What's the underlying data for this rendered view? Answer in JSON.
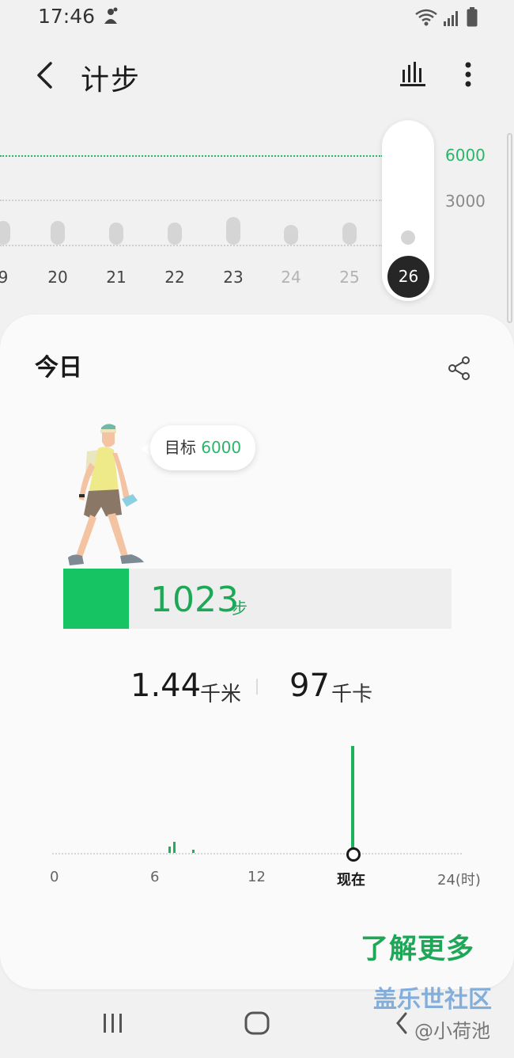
{
  "status_bar": {
    "time": "17:46",
    "icons": [
      "notification-icon",
      "wifi-icon",
      "signal-icon",
      "battery-icon"
    ]
  },
  "header": {
    "title": "计步",
    "icons": [
      "back-arrow-icon",
      "bar-chart-icon",
      "more-vertical-icon"
    ]
  },
  "week_chart": {
    "goal_label": "6000",
    "mid_label": "3000",
    "days": [
      {
        "label": "9",
        "steps": 1200,
        "future": false
      },
      {
        "label": "20",
        "steps": 1200,
        "future": false
      },
      {
        "label": "21",
        "steps": 1100,
        "future": false
      },
      {
        "label": "22",
        "steps": 1100,
        "future": false
      },
      {
        "label": "23",
        "steps": 1400,
        "future": false
      },
      {
        "label": "24",
        "steps": 1000,
        "future": true
      },
      {
        "label": "25",
        "steps": 1100,
        "future": true
      }
    ],
    "selected_day": "26",
    "selected_steps": 1023
  },
  "today": {
    "title": "今日",
    "goal_prefix": "目标",
    "goal_value": "6000",
    "steps": "1023",
    "steps_unit": "步",
    "progress": 0.17,
    "distance": "1.44",
    "distance_unit": "千米",
    "calories": "97",
    "calories_unit": "千卡"
  },
  "hourly_chart": {
    "axis_labels": [
      "0",
      "6",
      "12",
      "现在",
      "24(时)"
    ],
    "bars": [
      {
        "hour": 6.8,
        "steps": 60
      },
      {
        "hour": 7.1,
        "steps": 110
      },
      {
        "hour": 8.2,
        "steps": 30
      }
    ],
    "now_hour": 17.77,
    "now_steps": 1023
  },
  "learn_more": "了解更多",
  "watermark": {
    "forum": "盖乐世社区",
    "user": "@小荷池"
  },
  "nav_bar": {
    "icons": [
      "recent-apps-icon",
      "home-icon",
      "back-icon"
    ]
  },
  "colors": {
    "accent_green": "#16c463",
    "text_green": "#1da857",
    "selected_day_bg": "#262626"
  }
}
